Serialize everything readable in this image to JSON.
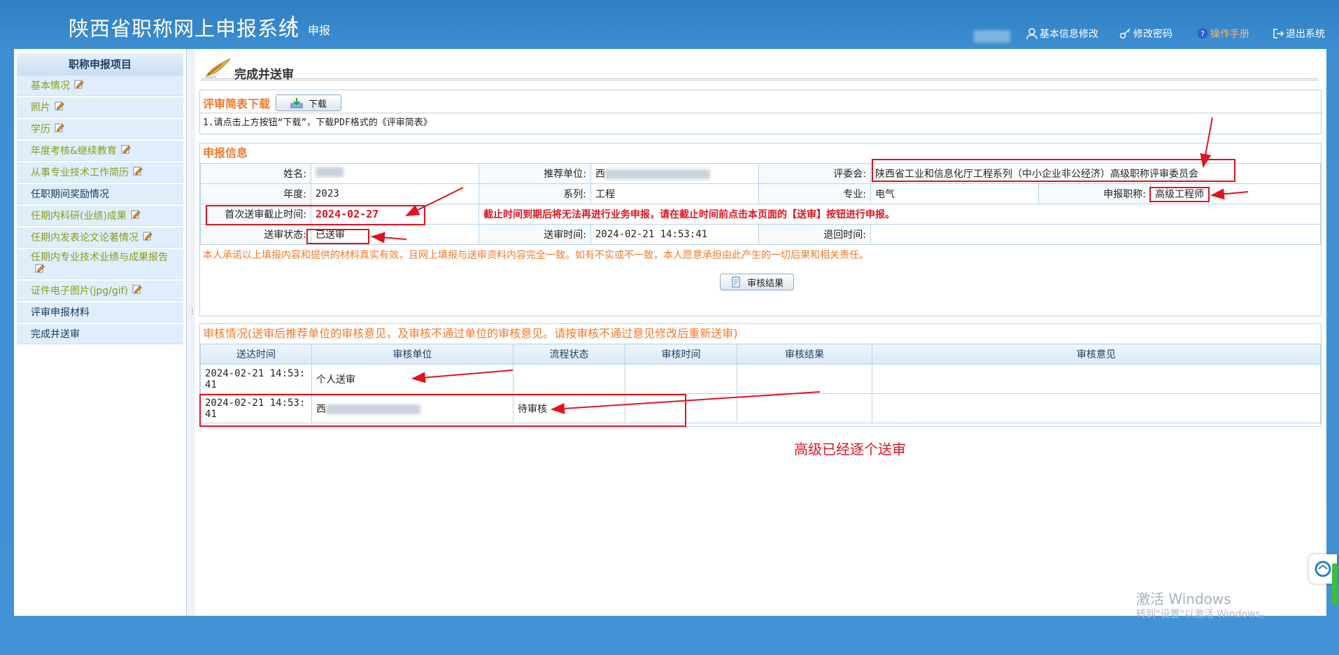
{
  "header": {
    "title": "陕西省职称网上申报系统",
    "separator": "|",
    "subtitle": "申报",
    "links": {
      "basic_info": "基本信息修改",
      "change_password": "修改密码",
      "manual": "操作手册",
      "logout": "退出系统"
    }
  },
  "sidebar": {
    "heading": "职称申报项目",
    "items": [
      {
        "label": "基本情况",
        "editable": true
      },
      {
        "label": "照片",
        "editable": true
      },
      {
        "label": "学历",
        "editable": true
      },
      {
        "label": "年度考核&继续教育",
        "editable": true
      },
      {
        "label": "从事专业技术工作简历",
        "editable": true
      },
      {
        "label": "任职期间奖励情况",
        "editable": false
      },
      {
        "label": "任期内科研(业绩)成果",
        "editable": true
      },
      {
        "label": "任期内发表论文论著情况",
        "editable": true
      },
      {
        "label": "任期内专业技术业绩与成果报告",
        "editable": true
      },
      {
        "label": "证件电子图片(jpg/gif)",
        "editable": true
      },
      {
        "label": "评审申报材料",
        "editable": false
      },
      {
        "label": "完成并送审",
        "editable": false
      }
    ]
  },
  "page": {
    "title": "完成并送审"
  },
  "download": {
    "title": "评审简表下载",
    "button": "下载",
    "note": "1.请点击上方按钮“下载”，下载PDF格式的《评审简表》"
  },
  "application": {
    "title": "申报信息",
    "labels": {
      "name": "姓名:",
      "unit": "推荐单位:",
      "committee": "评委会:",
      "year": "年度:",
      "series": "系列:",
      "major": "专业:",
      "title": "申报职称:",
      "deadline": "首次送审截止时间:",
      "status": "送审状态:",
      "submit_time": "送审时间:",
      "return_time": "退回时间:"
    },
    "values": {
      "unit_prefix": "西",
      "committee": "陕西省工业和信息化厅工程系列（中小企业非公经济）高级职称评审委员会",
      "year": "2023",
      "series": "工程",
      "major": "电气",
      "title": "高级工程师",
      "deadline": "2024-02-27",
      "status": "已送审",
      "submit_time": "2024-02-21 14:53:41",
      "return_time": ""
    },
    "warning": "截止时间到期后将无法再进行业务申报，请在截止时间前点击本页面的【送审】按钮进行申报。",
    "promise": "本人承诺以上填报内容和提供的材料真实有效，且网上填报与送审资料内容完全一致。如有不实或不一致，本人愿意承担由此产生的一切后果和相关责任。",
    "result_button": "审核结果"
  },
  "review": {
    "title": "审核情况(送审后推荐单位的审核意见，及审核不通过单位的审核意见。请按审核不通过意见修改后重新送审)",
    "columns": [
      "送达时间",
      "审核单位",
      "流程状态",
      "审核时间",
      "审核结果",
      "审核意见"
    ],
    "rows": [
      {
        "time": "2024-02-21 14:53:41",
        "unit": "个人送审",
        "status": "",
        "review_time": "",
        "result": "",
        "opinion": ""
      },
      {
        "time": "2024-02-21 14:53:41",
        "unit": "西",
        "status": "待审核",
        "review_time": "",
        "result": "",
        "opinion": ""
      }
    ]
  },
  "annotation": "高级已经逐个送审",
  "watermark": {
    "line1": "激活 Windows",
    "line2": "转到\"设置\"以激活 Windows。"
  },
  "colors": {
    "accent": "#f07a2c",
    "red": "#e0141e",
    "sidebar_text": "#8c9c1e"
  }
}
